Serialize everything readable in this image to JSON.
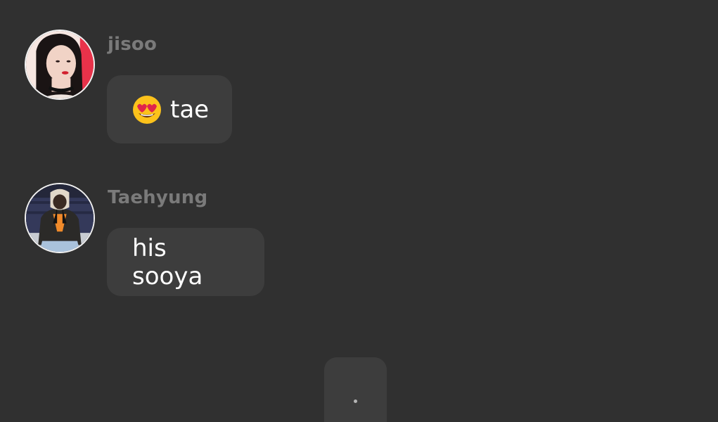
{
  "messages": [
    {
      "sender": "jisoo",
      "text": "tae",
      "emoji": "heart-eyes-emoji"
    },
    {
      "sender": "Taehyung",
      "text": "his sooya"
    }
  ],
  "typing_indicator": {
    "dots": "."
  }
}
